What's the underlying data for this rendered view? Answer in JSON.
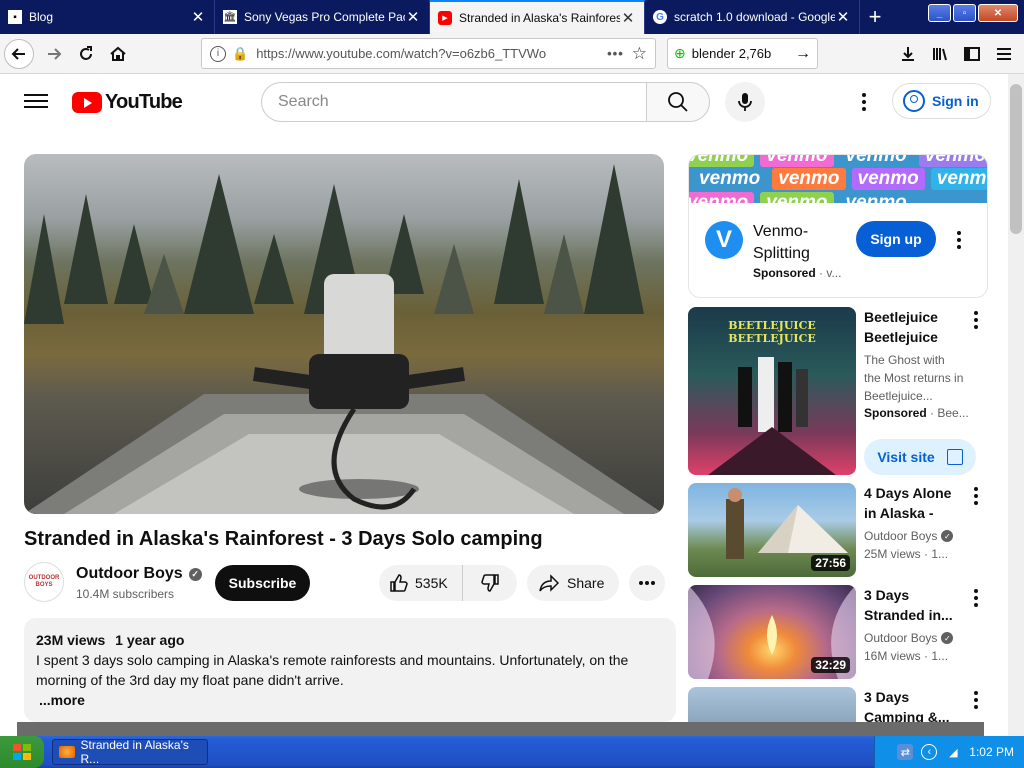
{
  "browser": {
    "tabs": [
      {
        "label": "Blog",
        "active": false
      },
      {
        "label": "Sony Vegas Pro Complete Pack",
        "active": false
      },
      {
        "label": "Stranded in Alaska's Rainforest",
        "active": true
      },
      {
        "label": "scratch 1.0 download - Google",
        "active": false
      }
    ],
    "url": "https://www.youtube.com/watch?v=o6zb6_TTVWo",
    "search_query": "blender 2,76b"
  },
  "youtube": {
    "logo_text": "YouTube",
    "search_placeholder": "Search",
    "sign_in": "Sign in"
  },
  "video": {
    "title": "Stranded in Alaska's Rainforest - 3 Days Solo camping",
    "channel": "Outdoor Boys",
    "subscribers": "10.4M subscribers",
    "subscribe_label": "Subscribe",
    "likes": "535K",
    "share_label": "Share",
    "views": "23M views",
    "age": "1 year ago",
    "description": "I spent 3 days solo camping in Alaska's remote rainforests and mountains. Unfortunately, on the morning of the 3rd day my float pane didn't arrive.",
    "more_label": "...more",
    "avatar_text": "OUTDOOR BOYS"
  },
  "sidebar": {
    "ad": {
      "banner_word": "venmo",
      "logo_letter": "V",
      "title": "Venmo-Splitting",
      "sponsored": "Sponsored",
      "sponsored_tail": "· v...",
      "cta": "Sign up"
    },
    "promo": {
      "title": "Beetlejuice Beetlejuice",
      "description": "The Ghost with the Most returns in Beetlejuice...",
      "sponsored": "Sponsored",
      "sponsored_tail": "· Bee...",
      "cta": "Visit site",
      "poster_text": "BEETLEJUICE BEETLEJUICE"
    },
    "videos": [
      {
        "title": "4 Days Alone in Alaska -",
        "channel": "Outdoor Boys",
        "meta": "25M views · 1...",
        "duration": "27:56"
      },
      {
        "title": "3 Days Stranded in...",
        "channel": "Outdoor Boys",
        "meta": "16M views · 1...",
        "duration": "32:29"
      },
      {
        "title": "3 Days Camping &...",
        "channel": "",
        "meta": "",
        "duration": ""
      }
    ]
  },
  "taskbar": {
    "start_label": "",
    "window_label": "Stranded in Alaska's R...",
    "clock": "1:02 PM"
  },
  "colors": {
    "accent": "#065fd4",
    "youtube_red": "#ff0000",
    "tabstrip": "#0b1a5e",
    "venmo": "#3d95ce"
  }
}
